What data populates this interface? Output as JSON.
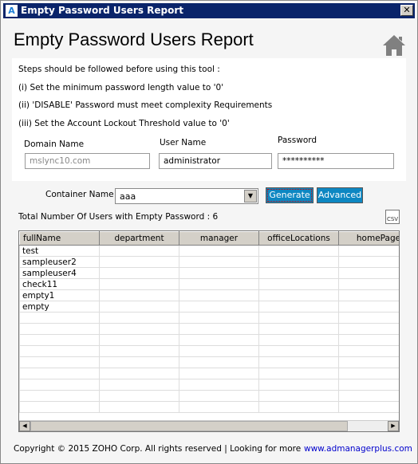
{
  "window": {
    "title": "Empty  Password Users Report",
    "app_icon": "A",
    "close": "✕"
  },
  "header": {
    "title": "Empty Password Users Report",
    "home_icon": "home-icon"
  },
  "steps": {
    "intro": "Steps should be followed before using this tool :",
    "items": [
      "(i) Set the minimum password length value to '0'",
      "(ii) 'DISABLE' Password must meet complexity Requirements",
      "(iii) Set the Account Lockout Threshold value to '0'"
    ]
  },
  "form": {
    "domain_label": "Domain Name",
    "domain_value": "mslync10.com",
    "user_label": "User Name",
    "user_value": "administrator",
    "password_label": "Password",
    "password_value": "**********"
  },
  "container": {
    "label": "Container Name",
    "value": "aaa"
  },
  "buttons": {
    "generate": "Generate",
    "advanced": "Advanced"
  },
  "total": "Total Number Of Users with Empty Password : 6",
  "csv_label": "CSV",
  "table": {
    "columns": [
      "fullName",
      "department",
      "manager",
      "officeLocations",
      "homePage"
    ],
    "rows": [
      "test",
      "sampleuser2",
      "sampleuser4",
      "check11",
      "empty1",
      "empty"
    ]
  },
  "footer": {
    "copyright": "Copyright © 2015 ZOHO Corp. All rights reserved | Looking for more",
    "link": "www.admanagerplus.com"
  }
}
